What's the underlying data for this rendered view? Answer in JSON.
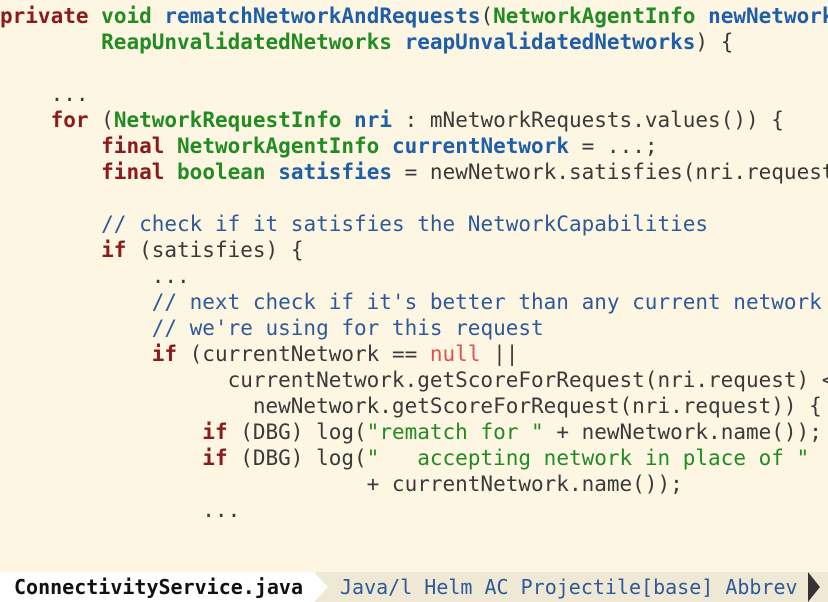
{
  "code": {
    "lines": [
      [
        {
          "c": "kw",
          "t": "private"
        },
        {
          "c": "tx",
          "t": " "
        },
        {
          "c": "ty",
          "t": "void"
        },
        {
          "c": "tx",
          "t": " "
        },
        {
          "c": "fn",
          "t": "rematchNetworkAndRequests"
        },
        {
          "c": "tx",
          "t": "("
        },
        {
          "c": "ty",
          "t": "NetworkAgentInfo"
        },
        {
          "c": "tx",
          "t": " "
        },
        {
          "c": "vr",
          "t": "newNetwork"
        },
        {
          "c": "tx",
          "t": ","
        }
      ],
      [
        {
          "c": "tx",
          "t": "        "
        },
        {
          "c": "ty",
          "t": "ReapUnvalidatedNetworks"
        },
        {
          "c": "tx",
          "t": " "
        },
        {
          "c": "vr",
          "t": "reapUnvalidatedNetworks"
        },
        {
          "c": "tx",
          "t": ") {"
        }
      ],
      [],
      [
        {
          "c": "tx",
          "t": "    ..."
        }
      ],
      [
        {
          "c": "tx",
          "t": "    "
        },
        {
          "c": "kw",
          "t": "for"
        },
        {
          "c": "tx",
          "t": " ("
        },
        {
          "c": "ty",
          "t": "NetworkRequestInfo"
        },
        {
          "c": "tx",
          "t": " "
        },
        {
          "c": "vr",
          "t": "nri"
        },
        {
          "c": "tx",
          "t": " : mNetworkRequests.values()) {"
        }
      ],
      [
        {
          "c": "tx",
          "t": "        "
        },
        {
          "c": "kw",
          "t": "final"
        },
        {
          "c": "tx",
          "t": " "
        },
        {
          "c": "ty",
          "t": "NetworkAgentInfo"
        },
        {
          "c": "tx",
          "t": " "
        },
        {
          "c": "vr",
          "t": "currentNetwork"
        },
        {
          "c": "tx",
          "t": " = ...;"
        }
      ],
      [
        {
          "c": "tx",
          "t": "        "
        },
        {
          "c": "kw",
          "t": "final"
        },
        {
          "c": "tx",
          "t": " "
        },
        {
          "c": "ty",
          "t": "boolean"
        },
        {
          "c": "tx",
          "t": " "
        },
        {
          "c": "vr",
          "t": "satisfies"
        },
        {
          "c": "tx",
          "t": " = newNetwork.satisfies(nri.request);"
        }
      ],
      [],
      [
        {
          "c": "tx",
          "t": "        "
        },
        {
          "c": "cm",
          "t": "// check if it satisfies the NetworkCapabilities"
        }
      ],
      [
        {
          "c": "tx",
          "t": "        "
        },
        {
          "c": "kw",
          "t": "if"
        },
        {
          "c": "tx",
          "t": " (satisfies) {"
        }
      ],
      [
        {
          "c": "tx",
          "t": "            ..."
        }
      ],
      [
        {
          "c": "tx",
          "t": "            "
        },
        {
          "c": "cm",
          "t": "// next check if it's better than any current network"
        }
      ],
      [
        {
          "c": "tx",
          "t": "            "
        },
        {
          "c": "cm",
          "t": "// we're using for this request"
        }
      ],
      [
        {
          "c": "tx",
          "t": "            "
        },
        {
          "c": "kw",
          "t": "if"
        },
        {
          "c": "tx",
          "t": " (currentNetwork == "
        },
        {
          "c": "cs",
          "t": "null"
        },
        {
          "c": "tx",
          "t": " ||"
        }
      ],
      [
        {
          "c": "tx",
          "t": "                  currentNetwork.getScoreForRequest(nri.request) <"
        }
      ],
      [
        {
          "c": "tx",
          "t": "                    newNetwork.getScoreForRequest(nri.request)) {"
        }
      ],
      [
        {
          "c": "tx",
          "t": "                "
        },
        {
          "c": "kw",
          "t": "if"
        },
        {
          "c": "tx",
          "t": " (DBG) log("
        },
        {
          "c": "st",
          "t": "\"rematch for \""
        },
        {
          "c": "tx",
          "t": " + newNetwork.name());"
        }
      ],
      [
        {
          "c": "tx",
          "t": "                "
        },
        {
          "c": "kw",
          "t": "if"
        },
        {
          "c": "tx",
          "t": " (DBG) log("
        },
        {
          "c": "st",
          "t": "\"   accepting network in place of \""
        }
      ],
      [
        {
          "c": "tx",
          "t": "                             + currentNetwork.name());"
        }
      ],
      [
        {
          "c": "tx",
          "t": "                ..."
        }
      ]
    ]
  },
  "modeline": {
    "filename": "ConnectivityService.java",
    "info": "Java/l Helm AC Projectile[base] Abbrev"
  }
}
